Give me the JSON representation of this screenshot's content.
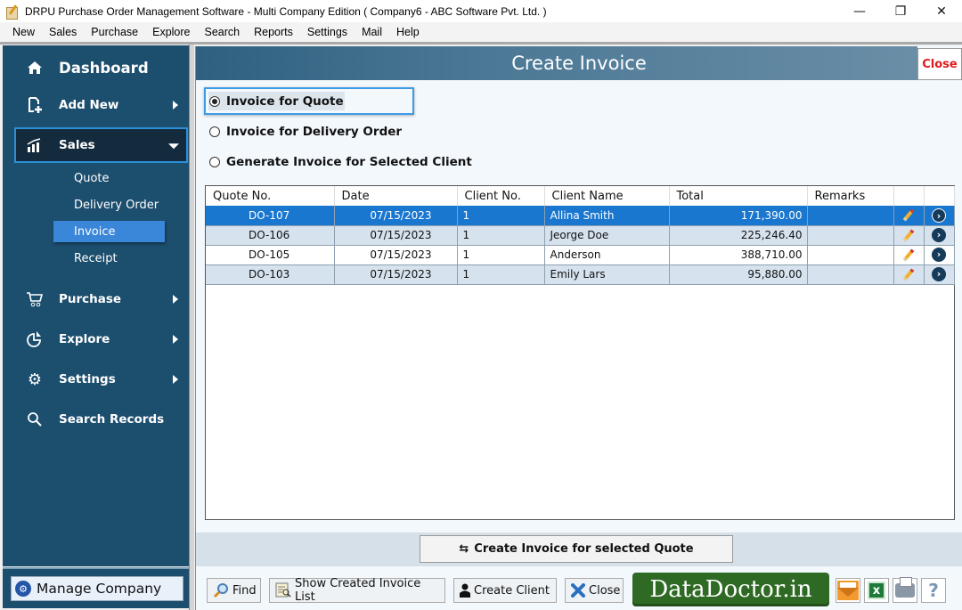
{
  "window": {
    "title": "DRPU Purchase Order Management Software - Multi Company Edition ( Company6 - ABC Software Pvt. Ltd. )",
    "controls": {
      "minimize": "—",
      "maximize": "❐",
      "close": "✕"
    }
  },
  "menu": [
    "New",
    "Sales",
    "Purchase",
    "Explore",
    "Search",
    "Reports",
    "Settings",
    "Mail",
    "Help"
  ],
  "sidebar": {
    "items": [
      {
        "label": "Dashboard",
        "icon": "home-icon"
      },
      {
        "label": "Add New",
        "icon": "add-document-icon"
      },
      {
        "label": "Sales",
        "icon": "chart-up-icon",
        "expanded": true
      },
      {
        "label": "Purchase",
        "icon": "cart-icon"
      },
      {
        "label": "Explore",
        "icon": "pie-chart-icon"
      },
      {
        "label": "Settings",
        "icon": "gear-icon"
      },
      {
        "label": "Search Records",
        "icon": "search-icon"
      }
    ],
    "sales_sub": [
      {
        "label": "Quote"
      },
      {
        "label": "Delivery Order"
      },
      {
        "label": "Invoice",
        "active": true
      },
      {
        "label": "Receipt"
      }
    ],
    "manage_company": "Manage Company"
  },
  "main": {
    "title": "Create Invoice",
    "close_label": "Close",
    "options": [
      {
        "label": "Invoice for Quote",
        "checked": true
      },
      {
        "label": "Invoice for Delivery Order",
        "checked": false
      },
      {
        "label": "Generate Invoice for Selected Client",
        "checked": false
      }
    ],
    "table": {
      "columns": [
        "Quote No.",
        "Date",
        "Client No.",
        "Client Name",
        "Total",
        "Remarks",
        "",
        ""
      ],
      "rows": [
        {
          "quote": "DO-107",
          "date": "07/15/2023",
          "client_no": "1",
          "client_name": "Allina Smith",
          "total": "171,390.00",
          "remarks": "",
          "selected": true
        },
        {
          "quote": "DO-106",
          "date": "07/15/2023",
          "client_no": "1",
          "client_name": "Jeorge Doe",
          "total": "225,246.40",
          "remarks": ""
        },
        {
          "quote": "DO-105",
          "date": "07/15/2023",
          "client_no": "1",
          "client_name": "Anderson",
          "total": "388,710.00",
          "remarks": ""
        },
        {
          "quote": "DO-103",
          "date": "07/15/2023",
          "client_no": "1",
          "client_name": "Emily Lars",
          "total": "95,880.00",
          "remarks": ""
        }
      ]
    },
    "create_button": "Create Invoice for selected Quote",
    "bottom": {
      "find": "Find",
      "show_list": "Show Created Invoice List",
      "create_client": "Create Client",
      "close": "Close",
      "brand": "DataDoctor.in"
    }
  },
  "colors": {
    "sidebar_bg": "#1c4e6e",
    "selected_row": "#1a77d0",
    "close_red": "#e0191c",
    "brand_green": "#2f6a24"
  }
}
